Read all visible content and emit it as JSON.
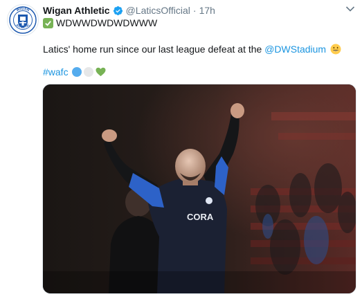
{
  "tweet": {
    "display_name": "Wigan Athletic",
    "handle": "@LaticsOfficial",
    "separator": "·",
    "time": "17h",
    "subline_text": "WDWWDWDWDWWW",
    "body_text": "Latics' home run since our last league defeat at the ",
    "mention": "@DWStadium",
    "hashtag": "#wafc",
    "icons": {
      "verified": "verified-badge-icon",
      "check": "green-check-icon",
      "smile": "smiling-face-icon",
      "chevron": "chevron-down-icon"
    },
    "colors": {
      "link": "#1b95e0",
      "verified": "#1da1f2",
      "check_green": "#77b255",
      "blue_circle": "#55acee",
      "white_circle": "#e6e7e8",
      "green_heart": "#77b255"
    },
    "avatar": {
      "crest_lines": [
        "WIGAN",
        "ATHLETIC"
      ]
    },
    "image": {
      "shirt_sponsor": "CORA"
    }
  }
}
